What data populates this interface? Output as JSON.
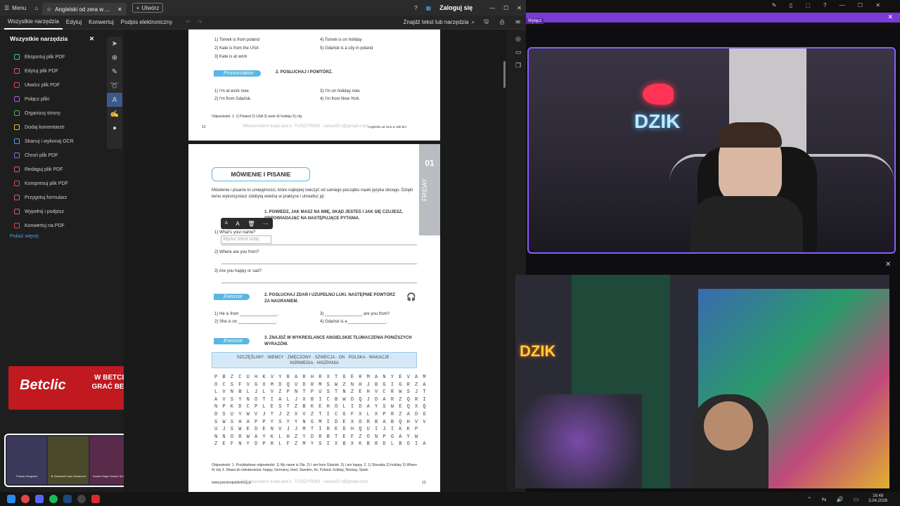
{
  "titlebar": {
    "menu_label": "Menu",
    "tab_title": "Angielski od zera w ...",
    "create_label": "Utwórz",
    "signin_label": "Zaloguj się"
  },
  "menubar": {
    "items": [
      "Wszystkie narzędzia",
      "Edytuj",
      "Konwertuj",
      "Podpis elektroniczny"
    ],
    "find_label": "Znajdź tekst lub narzędzia"
  },
  "sidebar": {
    "title": "Wszystkie narzędzia",
    "items": [
      {
        "label": "Eksportuj plik PDF",
        "color": "#3ec28f"
      },
      {
        "label": "Edytuj plik PDF",
        "color": "#e0508c"
      },
      {
        "label": "Utwórz plik PDF",
        "color": "#e04848"
      },
      {
        "label": "Połącz pliki",
        "color": "#a55cf0"
      },
      {
        "label": "Organizuj strony",
        "color": "#4caf50"
      },
      {
        "label": "Dodaj komentarze",
        "color": "#e8c020"
      },
      {
        "label": "Skanuj i wykonaj OCR",
        "color": "#4aa3e8"
      },
      {
        "label": "Chroń plik PDF",
        "color": "#a55cf0"
      },
      {
        "label": "Redaguj plik PDF",
        "color": "#e0508c"
      },
      {
        "label": "Kompresuj plik PDF",
        "color": "#e04848"
      },
      {
        "label": "Przygotuj formularz",
        "color": "#e0508c"
      },
      {
        "label": "Wypełnij i podpisz",
        "color": "#e0508c"
      },
      {
        "label": "Konwertuj na PDF",
        "color": "#e04848"
      }
    ],
    "show_more": "Pokaż więcej"
  },
  "page1": {
    "lines_left": [
      "1)  Tomek is from poland",
      "2)  Kate is from the USA",
      "3)  Kate is at work"
    ],
    "lines_right": [
      "4)  Tomek is on holiday",
      "5)  Gdańsk is a city in poland"
    ],
    "pronunciation": "Pronunciation",
    "listen": "2.   POSŁUCHAJ I POWTÓRZ.",
    "rep_left": [
      "1)  I'm at work now.",
      "2)  I'm from Gdańsk."
    ],
    "rep_right": [
      "3)  I'm on holiday now.",
      "4)  I'm from New York."
    ],
    "answers": "Odpowiedzi: 1. 1) Poland 2) USA 3) work 4) holiday 5) city",
    "page_num": "12",
    "footer": "Właścicielem kopii jest Ł. TUSZYŃSKI - lukas92.t@gmail.com",
    "footer_right": "Angielski od zera w 180 dni"
  },
  "page2": {
    "title": "MÓWIENIE I PISANIE",
    "side_label": "FRIDAY",
    "week": "01",
    "intro": "Mówienie i pisanie to umiejętności, które najlepiej ćwiczyć od samego początku nauki języka obcego. Dzięki temu wykorzystasz zdobytą wiedzę w praktyce i utrwalisz ją!",
    "ex1_title": "1.   POWIEDZ, JAK MASZ NA IMIĘ, SKĄD JESTEŚ I JAK SIĘ CZUJESZ, ODPOWIADAJĄC NA NASTĘPUJĄCE PYTANIA.",
    "q1": "1)  What's your name?",
    "text_placeholder": "Wpisz tekst tutaj",
    "q2": "2)  Where are you from?",
    "q3": "3)  Are you happy or sad?",
    "exercise": "Exercise",
    "ex2_title": "2.   POSŁUCHAJ ZDAŃ I UZUPEŁNIJ LUKI. NASTĘPNIE POWTÓRZ ZA NAGRANIEM.",
    "ex2_lines": [
      "1)  He is from ________________.",
      "2)  She is on ________________.",
      "3)  ________________ are you from?",
      "4)  Gdańsk is a ________________."
    ],
    "ex3_title": "3.   ZNAJDŹ W WYKREŚLANCE ANGIELSKIE TŁUMACZENIA PONIŻSZYCH WYRAZÓW.",
    "words": "SZCZĘŚLIWY · NIEMCY · ZMĘCZONY · SZWECJA · ON · POLSKA · WAKACJE · NORWEGIA · HISZPANIA",
    "grid": [
      "P B Z C U H K V Y R A R H R X T G E R M A N Y E V A M",
      "O C S F V G X M D Q V D R M S W Z N H J B G I G R Z A",
      "L V N B L J L V Z P N T P U S T N Z E H V C R W S J T",
      "A V S Y N O T I A L J X B I C B W D Q J D A R Z Q R I",
      "N P K D C P L E S T Z B K E H O L I D A Y S W E Q X Q",
      "D S U Y W V J T J Z X V Z T I C G F X L X P R Z A D G",
      "S W S H A P P Y S Y Y N G M I D E X O R B A B Q H V V",
      "U J S W E D E N V J J M T I R E D H Q U I J I K K P",
      "N N O R W A Y K L H Z Y D R B T E F Z O N P G A Y W",
      "Z E F N Y D P R L F Z M Y S I X B X K B R D L B O I A"
    ],
    "answers": "Odpowiedzi: 1. Przykładowe odpowiedzi: 1) My name is Ola. 2) I am from Gdańsk. 3) I am happy. 2. 1) Slovakia 2) holiday 3) Where 4) city 3. Słowa do odnalezienia: happy, Germany, tired, Sweden, he, Poland, holiday, Norway, Spain",
    "website": "www.prestonpublishing.pl",
    "footer": "Właścicielem kopii jest Ł. TUSZYŃSKI - lukas92.t@gmail.com",
    "page_num": "13"
  },
  "overlay": {
    "ad_brand": "Betclic",
    "ad_text": "W BETCLIC MOŻESZ GRAĆ BEZ PODATKU!",
    "skins": [
      "Famas Sergeant",
      "★ Karambit Case Hardened",
      "Desert Eagle Sunset Storm"
    ],
    "dzik_logo": "DZIK",
    "purple_bar_text": "Wyłącz"
  },
  "taskbar": {
    "time": "16:48",
    "date": "3.04.2026"
  }
}
